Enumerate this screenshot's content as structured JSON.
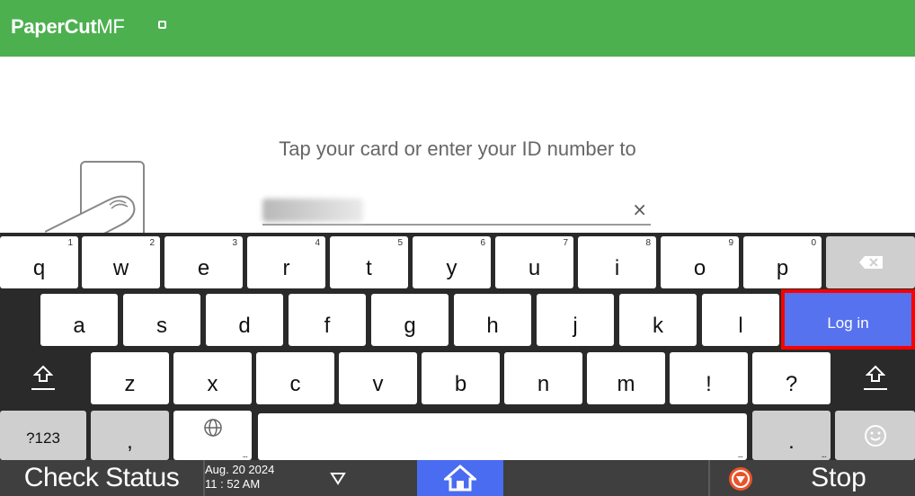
{
  "header": {
    "logo_bold": "PaperCut",
    "logo_light": "MF"
  },
  "content": {
    "prompt": "Tap your card or enter your ID number to",
    "id_input": {
      "clear_symbol": "×"
    }
  },
  "keyboard": {
    "row1": [
      {
        "label": "q",
        "num": "1"
      },
      {
        "label": "w",
        "num": "2"
      },
      {
        "label": "e",
        "num": "3"
      },
      {
        "label": "r",
        "num": "4"
      },
      {
        "label": "t",
        "num": "5"
      },
      {
        "label": "y",
        "num": "6"
      },
      {
        "label": "u",
        "num": "7"
      },
      {
        "label": "i",
        "num": "8"
      },
      {
        "label": "o",
        "num": "9"
      },
      {
        "label": "p",
        "num": "0"
      }
    ],
    "row2": [
      "a",
      "s",
      "d",
      "f",
      "g",
      "h",
      "j",
      "k",
      "l"
    ],
    "row3": [
      "z",
      "x",
      "c",
      "v",
      "b",
      "n",
      "m",
      "!",
      "?"
    ],
    "login_label": "Log in",
    "symbols_label": "?123",
    "comma_label": ",",
    "period_label": ".",
    "more_dots": "...",
    "icons": {
      "backspace": "backspace-icon",
      "shift": "shift-icon",
      "globe": "globe-icon",
      "emoji": "emoji-icon"
    }
  },
  "bottom_bar": {
    "check_status": "Check Status",
    "date": "Aug. 20 2024",
    "time": "11 : 52 AM",
    "stop": "Stop"
  },
  "colors": {
    "header_green": "#4cb04f",
    "login_blue": "#5772ee",
    "highlight_red": "#ff0000",
    "home_blue": "#4a6cf0",
    "stop_orange": "#e8542a"
  }
}
